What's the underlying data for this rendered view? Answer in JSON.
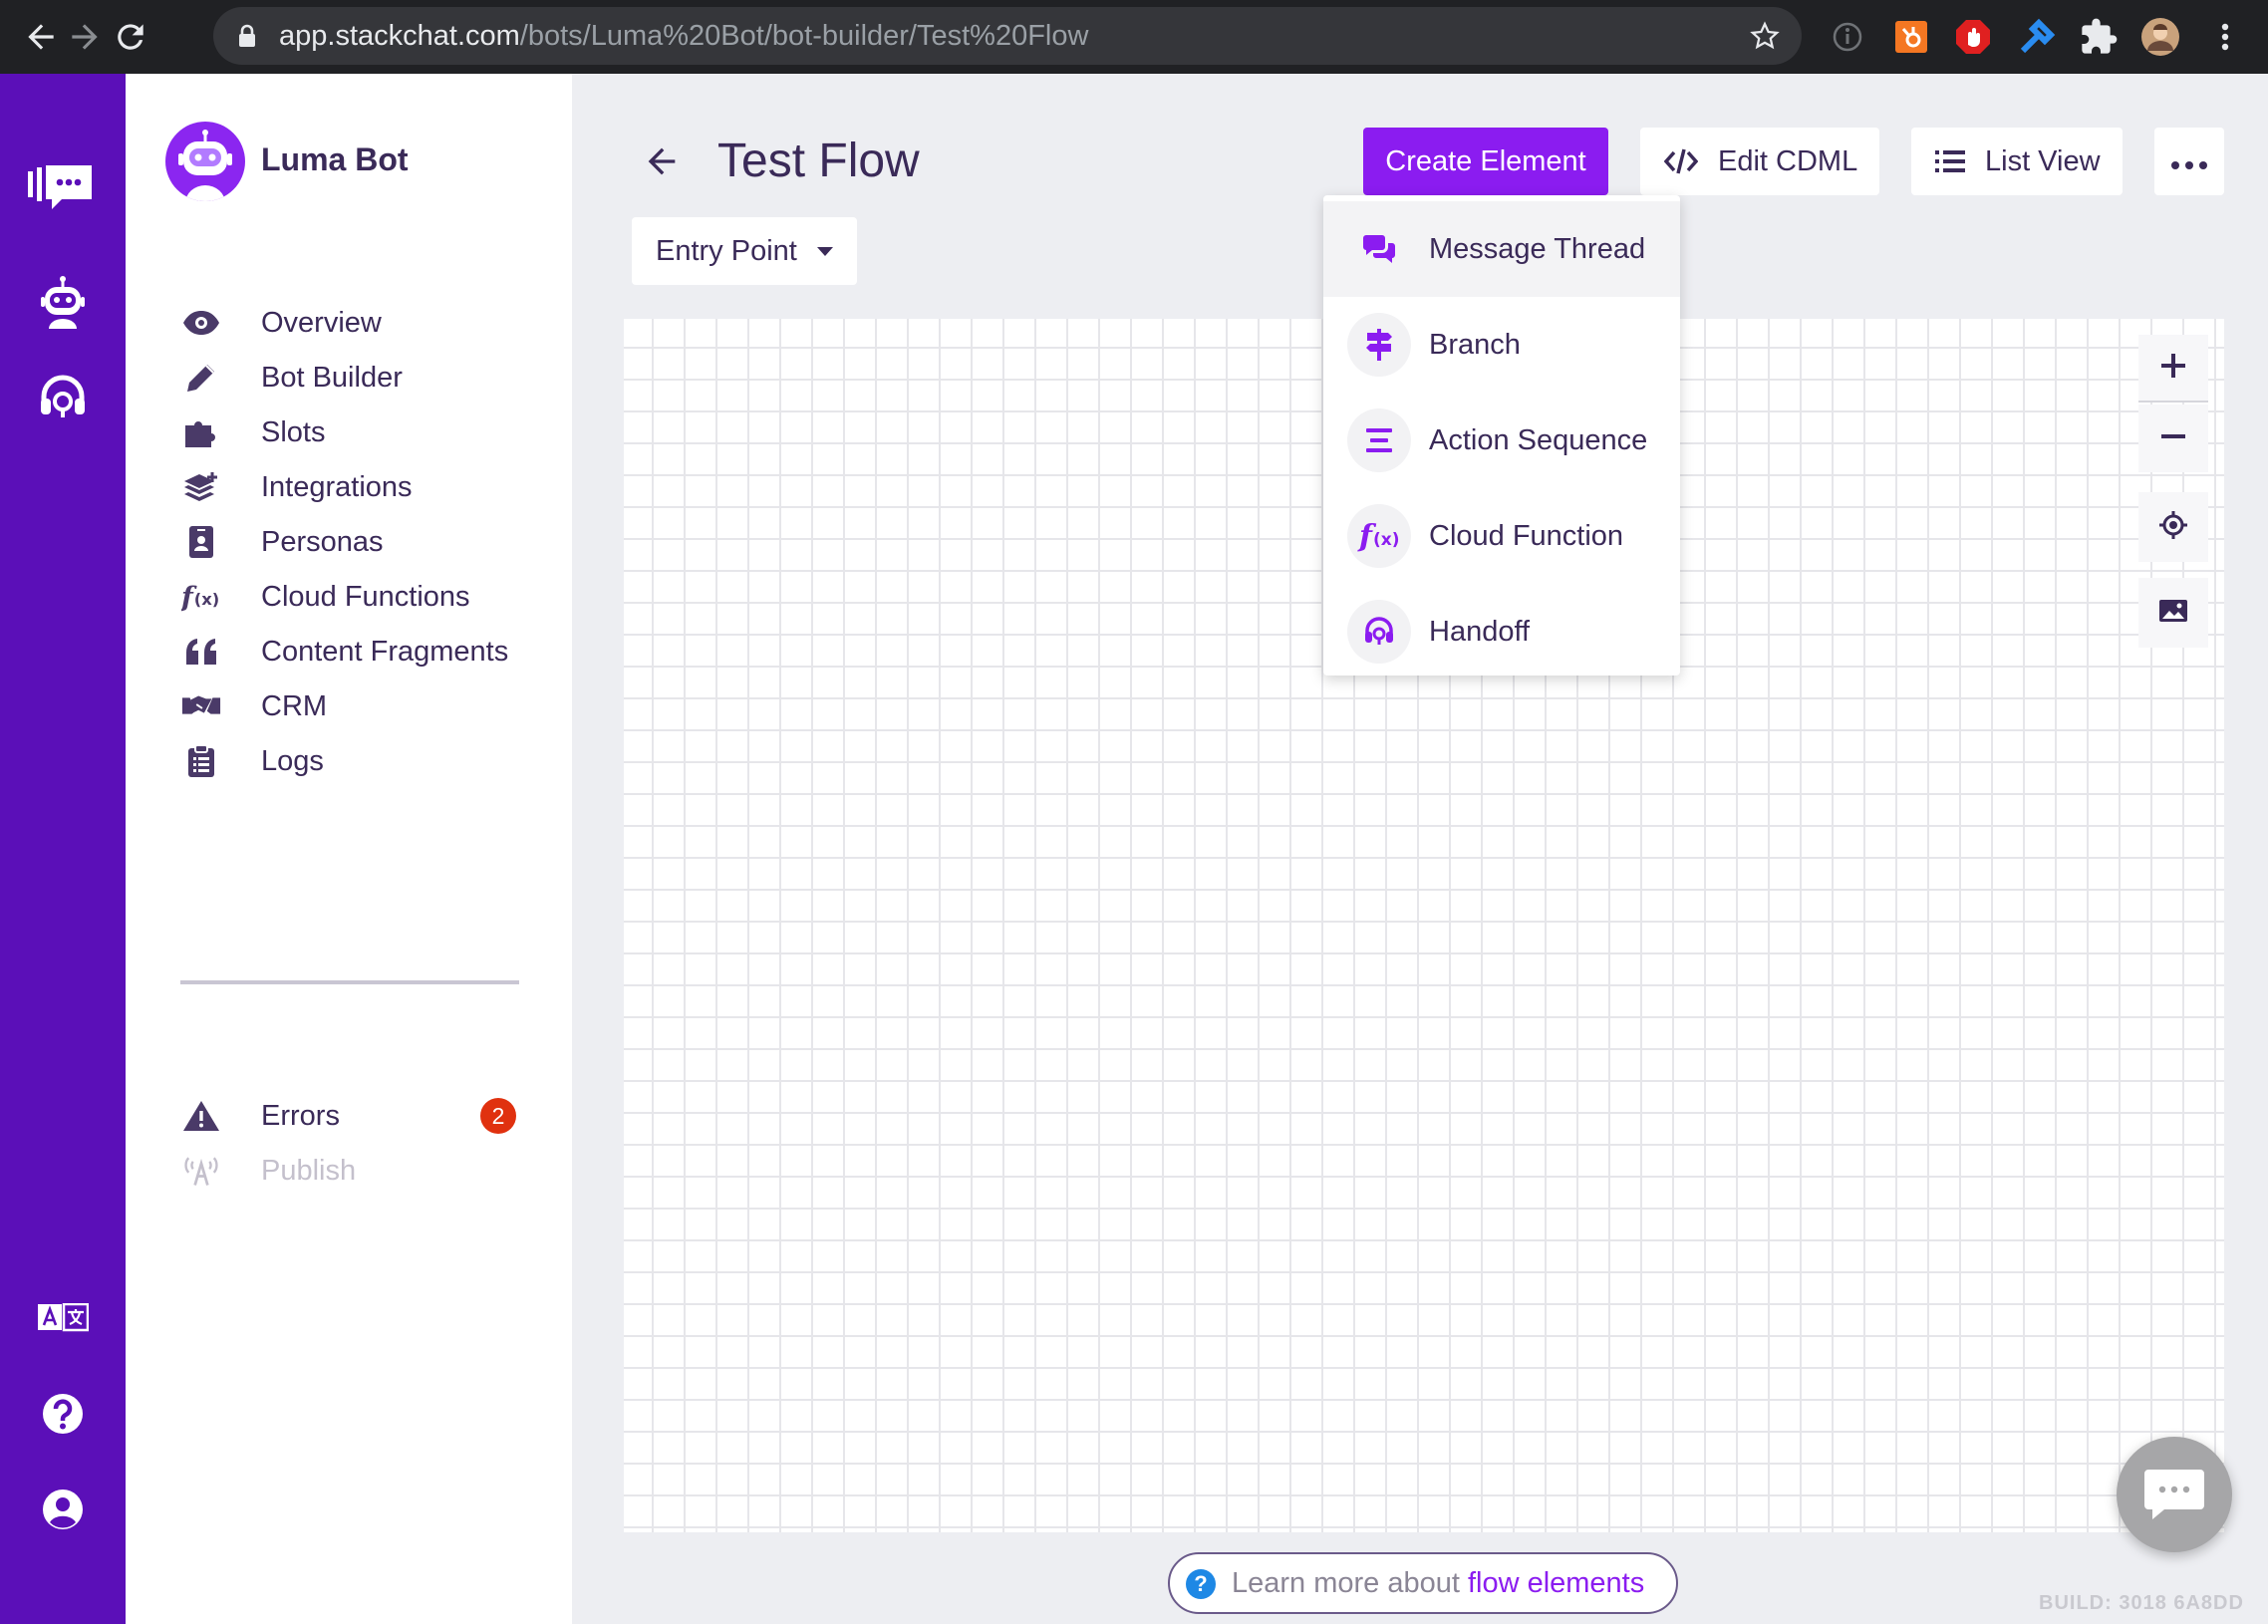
{
  "browser": {
    "url_host": "app.stackchat.com",
    "url_path": "/bots/Luma%20Bot/bot-builder/Test%20Flow"
  },
  "sidebar": {
    "bot_name": "Luma Bot",
    "items": [
      {
        "label": "Overview",
        "icon": "eye-icon"
      },
      {
        "label": "Bot Builder",
        "icon": "pencil-icon"
      },
      {
        "label": "Slots",
        "icon": "puzzle-icon"
      },
      {
        "label": "Integrations",
        "icon": "layers-plus-icon"
      },
      {
        "label": "Personas",
        "icon": "id-badge-icon"
      },
      {
        "label": "Cloud Functions",
        "icon": "function-icon"
      },
      {
        "label": "Content Fragments",
        "icon": "quote-icon"
      },
      {
        "label": "CRM",
        "icon": "handshake-icon"
      },
      {
        "label": "Logs",
        "icon": "clipboard-list-icon"
      }
    ],
    "errors": {
      "label": "Errors",
      "count": "2"
    },
    "publish": {
      "label": "Publish"
    }
  },
  "header": {
    "title": "Test Flow",
    "create_label": "Create Element",
    "edit_cdml_label": "Edit CDML",
    "list_view_label": "List View",
    "entry_point_label": "Entry Point"
  },
  "create_menu": {
    "items": [
      {
        "label": "Message Thread",
        "icon": "comments-icon"
      },
      {
        "label": "Branch",
        "icon": "signpost-icon"
      },
      {
        "label": "Action Sequence",
        "icon": "align-center-icon"
      },
      {
        "label": "Cloud Function",
        "icon": "function-icon"
      },
      {
        "label": "Handoff",
        "icon": "headset-icon"
      }
    ]
  },
  "footer": {
    "learn_text": "Learn more about",
    "learn_link": "flow elements",
    "build": "BUILD: 3018 6A8DD"
  },
  "colors": {
    "brand_purple": "#5b0fb8",
    "accent_purple": "#8b1cf0",
    "text_dark": "#3a2a58",
    "error_badge": "#e0310f"
  }
}
